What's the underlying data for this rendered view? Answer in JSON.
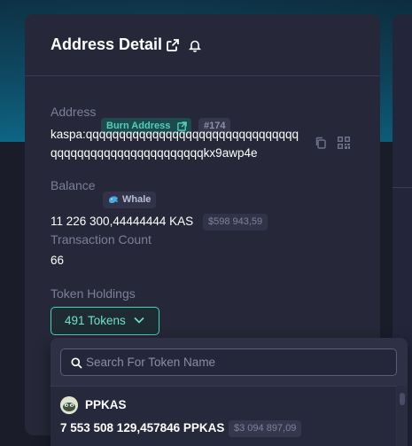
{
  "header": {
    "title": "Address Detail",
    "icons": [
      "external-link-icon",
      "bell-icon"
    ]
  },
  "address": {
    "label": "Address",
    "badge": "Burn Address",
    "index_badge": "#174",
    "line1": "kaspa:qqqqqqqqqqqqqqqqqqqqqqqqqqqqqqqq",
    "line2": "qqqqqqqqqqqqqqqqqqqqqqqkx9awp4e",
    "icons": [
      "copy-icon",
      "qr-code-icon"
    ]
  },
  "balance": {
    "label": "Balance",
    "badge": "Whale",
    "value": "11 226 300,44444444 KAS",
    "usd": "$598 943,59"
  },
  "transactions": {
    "label": "Transaction Count",
    "value": "66"
  },
  "tokens": {
    "label": "Token Holdings",
    "button": "491 Tokens",
    "search_placeholder": "Search For Token Name",
    "items": [
      {
        "name": "PPKAS",
        "amount": "7 553 508 129,457846 PPKAS",
        "usd": "$3 094 897,09"
      }
    ]
  },
  "colors": {
    "accent": "#45d4bb",
    "card_bg": "#262839",
    "page_bg": "#1b1d2c",
    "header_bg": "#0f4d68"
  }
}
